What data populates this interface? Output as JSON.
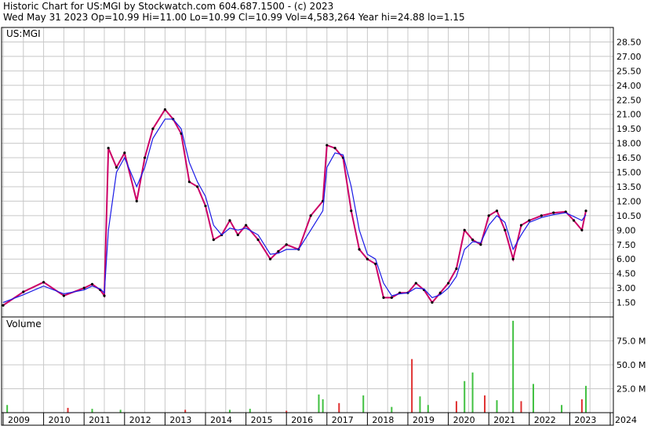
{
  "header": {
    "title": "Historic Chart for US:MGI by Stockwatch.com 604.687.1500 - (c) 2023",
    "quote": "Wed May 31 2023   Op=10.99  Hi=11.00  Lo=10.99  Cl=10.99  Vol=4,583,264   Year hi=24.88  lo=1.15"
  },
  "chart_data": [
    {
      "type": "line",
      "label": "US:MGI",
      "yaxis_side": "right",
      "ylim": [
        0,
        30
      ],
      "yticks": [
        "28.50",
        "27.00",
        "25.50",
        "24.00",
        "22.50",
        "21.00",
        "19.50",
        "18.00",
        "16.50",
        "15.00",
        "13.50",
        "12.00",
        "10.50",
        "9.00",
        "7.50",
        "6.00",
        "4.50",
        "3.00",
        "1.50"
      ],
      "grid": true,
      "x": [
        "2009.0",
        "2009.5",
        "2010.0",
        "2010.5",
        "2011.0",
        "2011.2",
        "2011.4",
        "2011.5",
        "2011.6",
        "2011.8",
        "2012.0",
        "2012.3",
        "2012.5",
        "2012.7",
        "2013.0",
        "2013.2",
        "2013.4",
        "2013.6",
        "2013.8",
        "2014.0",
        "2014.2",
        "2014.4",
        "2014.6",
        "2014.8",
        "2015.0",
        "2015.3",
        "2015.6",
        "2015.8",
        "2016.0",
        "2016.3",
        "2016.6",
        "2016.9",
        "2017.0",
        "2017.2",
        "2017.4",
        "2017.6",
        "2017.8",
        "2018.0",
        "2018.2",
        "2018.4",
        "2018.6",
        "2018.8",
        "2019.0",
        "2019.2",
        "2019.4",
        "2019.6",
        "2019.8",
        "2020.0",
        "2020.2",
        "2020.4",
        "2020.6",
        "2020.8",
        "2021.0",
        "2021.2",
        "2021.4",
        "2021.6",
        "2021.8",
        "2022.0",
        "2022.3",
        "2022.6",
        "2022.9",
        "2023.1",
        "2023.3",
        "2023.4"
      ],
      "series": [
        {
          "name": "",
          "color": "#cc0066",
          "values": [
            1.2,
            2.6,
            3.6,
            2.2,
            3.0,
            3.4,
            2.8,
            2.2,
            17.5,
            15.5,
            17.0,
            12.0,
            16.5,
            19.5,
            21.5,
            20.5,
            19.0,
            14.0,
            13.5,
            11.5,
            8.0,
            8.5,
            10.0,
            8.5,
            9.5,
            8.0,
            6.0,
            6.8,
            7.5,
            7.0,
            10.5,
            12.0,
            17.8,
            17.5,
            16.5,
            11.0,
            7.0,
            6.0,
            5.5,
            2.0,
            2.0,
            2.5,
            2.5,
            3.5,
            2.8,
            1.5,
            2.5,
            3.5,
            5.0,
            9.0,
            8.0,
            7.5,
            10.5,
            11.0,
            9.0,
            6.0,
            9.5,
            10.0,
            10.5,
            10.8,
            10.9,
            10.0,
            9.0,
            11.0
          ]
        },
        {
          "name": "",
          "color": "#1a1ae6",
          "values": [
            1.5,
            2.3,
            3.2,
            2.4,
            2.8,
            3.2,
            2.9,
            2.5,
            9.0,
            15.0,
            16.5,
            13.5,
            15.5,
            18.5,
            20.5,
            20.5,
            19.5,
            16.0,
            14.0,
            12.5,
            9.5,
            8.5,
            9.2,
            9.0,
            9.2,
            8.5,
            6.5,
            6.6,
            7.0,
            7.0,
            9.0,
            11.0,
            15.5,
            17.0,
            16.8,
            13.5,
            9.0,
            6.5,
            6.0,
            3.5,
            2.2,
            2.4,
            2.5,
            3.0,
            2.9,
            2.0,
            2.3,
            3.0,
            4.2,
            7.0,
            7.8,
            7.7,
            9.5,
            10.5,
            9.8,
            7.0,
            8.5,
            9.8,
            10.3,
            10.6,
            10.8,
            10.4,
            10.0,
            10.6
          ]
        }
      ],
      "xlabels": [
        "2009",
        "2010",
        "2011",
        "2012",
        "2013",
        "2014",
        "2015",
        "2016",
        "2017",
        "2018",
        "2019",
        "2020",
        "2021",
        "2022",
        "2023",
        "2024"
      ]
    },
    {
      "type": "bar",
      "label": "Volume",
      "yaxis_side": "right",
      "ylim": [
        0,
        100
      ],
      "yticks": [
        "75.0 M",
        "50.0 M",
        "25.0 M"
      ],
      "grid": true,
      "x": [
        2009.1,
        2010.6,
        2011.2,
        2011.9,
        2013.5,
        2014.6,
        2015.1,
        2016.0,
        2016.8,
        2016.9,
        2017.3,
        2017.9,
        2018.6,
        2019.1,
        2019.3,
        2019.5,
        2020.2,
        2020.4,
        2020.6,
        2020.9,
        2021.2,
        2021.6,
        2021.8,
        2022.1,
        2022.8,
        2023.3,
        2023.4
      ],
      "values": [
        8,
        5,
        4,
        3,
        3,
        3,
        4,
        2,
        19,
        14,
        10,
        18,
        6,
        56,
        17,
        8,
        12,
        33,
        42,
        18,
        13,
        96,
        12,
        30,
        8,
        14,
        28
      ]
    }
  ]
}
